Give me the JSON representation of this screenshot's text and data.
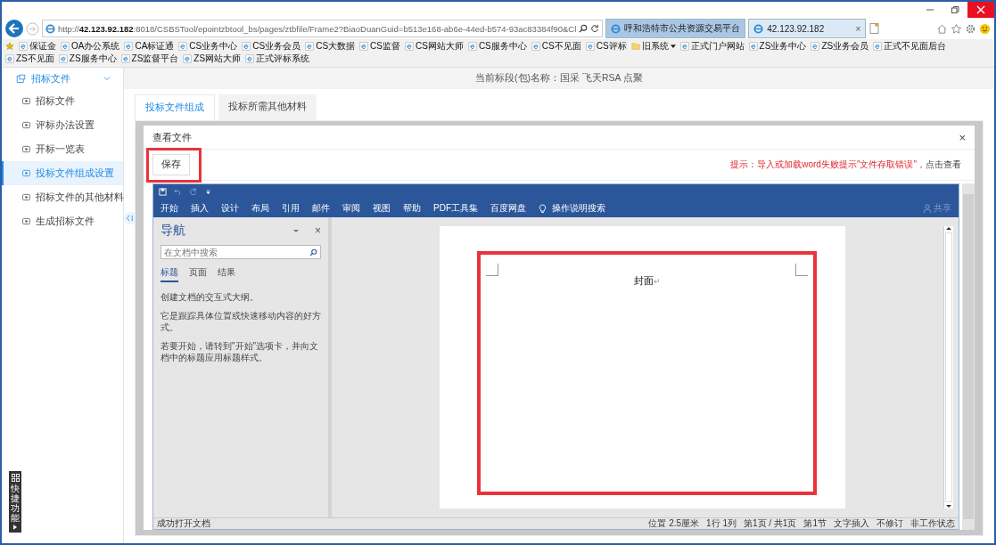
{
  "browser": {
    "address": "http://**42.123.92.182**:8018/CSBSTool/epointzbtool_bs/pages/ztbfile/Frame2?BiaoDuanGuid=b513e168-ab6e-44ed-b574-93ac83384f90&Cl",
    "tabs": [
      {
        "label": "呼和浩特市公共资源交易平台",
        "selected": false
      },
      {
        "label": "42.123.92.182",
        "selected": true
      }
    ],
    "tab_close": "×",
    "bookmarks": [
      {
        "label": "保证金",
        "kind": "link"
      },
      {
        "label": "OA办公系统",
        "kind": "link"
      },
      {
        "label": "CA标证通",
        "kind": "link"
      },
      {
        "label": "CS业务中心",
        "kind": "link"
      },
      {
        "label": "CS业务会员",
        "kind": "link"
      },
      {
        "label": "CS大数据",
        "kind": "link"
      },
      {
        "label": "CS监督",
        "kind": "link"
      },
      {
        "label": "CS网站大师",
        "kind": "link"
      },
      {
        "label": "CS服务中心",
        "kind": "link"
      },
      {
        "label": "CS不见面",
        "kind": "link"
      },
      {
        "label": "CS评标",
        "kind": "link"
      },
      {
        "label": "旧系统",
        "kind": "folder"
      },
      {
        "label": "正式门户网站",
        "kind": "link"
      },
      {
        "label": "ZS业务中心",
        "kind": "link"
      },
      {
        "label": "ZS业务会员",
        "kind": "link"
      },
      {
        "label": "正式不见面后台",
        "kind": "link"
      },
      {
        "label": "ZS不见面",
        "kind": "link"
      },
      {
        "label": "ZS服务中心",
        "kind": "link"
      },
      {
        "label": "ZS监督平台",
        "kind": "link"
      },
      {
        "label": "ZS网站大师",
        "kind": "link"
      },
      {
        "label": "正式评标系统",
        "kind": "link"
      }
    ]
  },
  "sidebar": {
    "title": "招标文件",
    "expanded": true,
    "items": [
      {
        "label": "招标文件",
        "selected": false
      },
      {
        "label": "评标办法设置",
        "selected": false
      },
      {
        "label": "开标一览表",
        "selected": false
      },
      {
        "label": "投标文件组成设置",
        "selected": true
      },
      {
        "label": "招标文件的其他材料",
        "selected": false
      },
      {
        "label": "生成招标文件",
        "selected": false
      }
    ]
  },
  "header": "当前标段(包)名称：国采 飞天RSA 点聚",
  "tabs": [
    {
      "label": "投标文件组成",
      "selected": true
    },
    {
      "label": "投标所需其他材料",
      "selected": false
    }
  ],
  "dialog": {
    "title": "查看文件",
    "close": "×",
    "save": "保存",
    "hint": "提示：导入或加载word失败提示\"文件存取错误\"，",
    "hint_link": "点击查看"
  },
  "word": {
    "ribbon_tabs": [
      "开始",
      "插入",
      "设计",
      "布局",
      "引用",
      "邮件",
      "审阅",
      "视图",
      "帮助",
      "PDF工具集",
      "百度网盘"
    ],
    "tell_me": "操作说明搜索",
    "share": "共享",
    "nav": {
      "title": "导航",
      "close": "×",
      "placeholder": "在文档中搜索",
      "tabs": [
        {
          "label": "标题",
          "selected": true
        },
        {
          "label": "页面",
          "selected": false
        },
        {
          "label": "结果",
          "selected": false
        }
      ],
      "paragraphs": [
        "创建文档的交互式大纲。",
        "它是跟踪具体位置或快速移动内容的好方式。",
        "若要开始，请转到\"开始\"选项卡，并向文档中的标题应用标题样式。"
      ]
    },
    "page_text": "封面",
    "paragraph_mark": "↵",
    "status": [
      "成功打开文档",
      "位置 2.5厘米",
      "1行 1列",
      "第1页 / 共1页",
      "第1节",
      "文字插入",
      "不修订",
      "非工作状态"
    ]
  },
  "quick_panel": "快捷功能"
}
